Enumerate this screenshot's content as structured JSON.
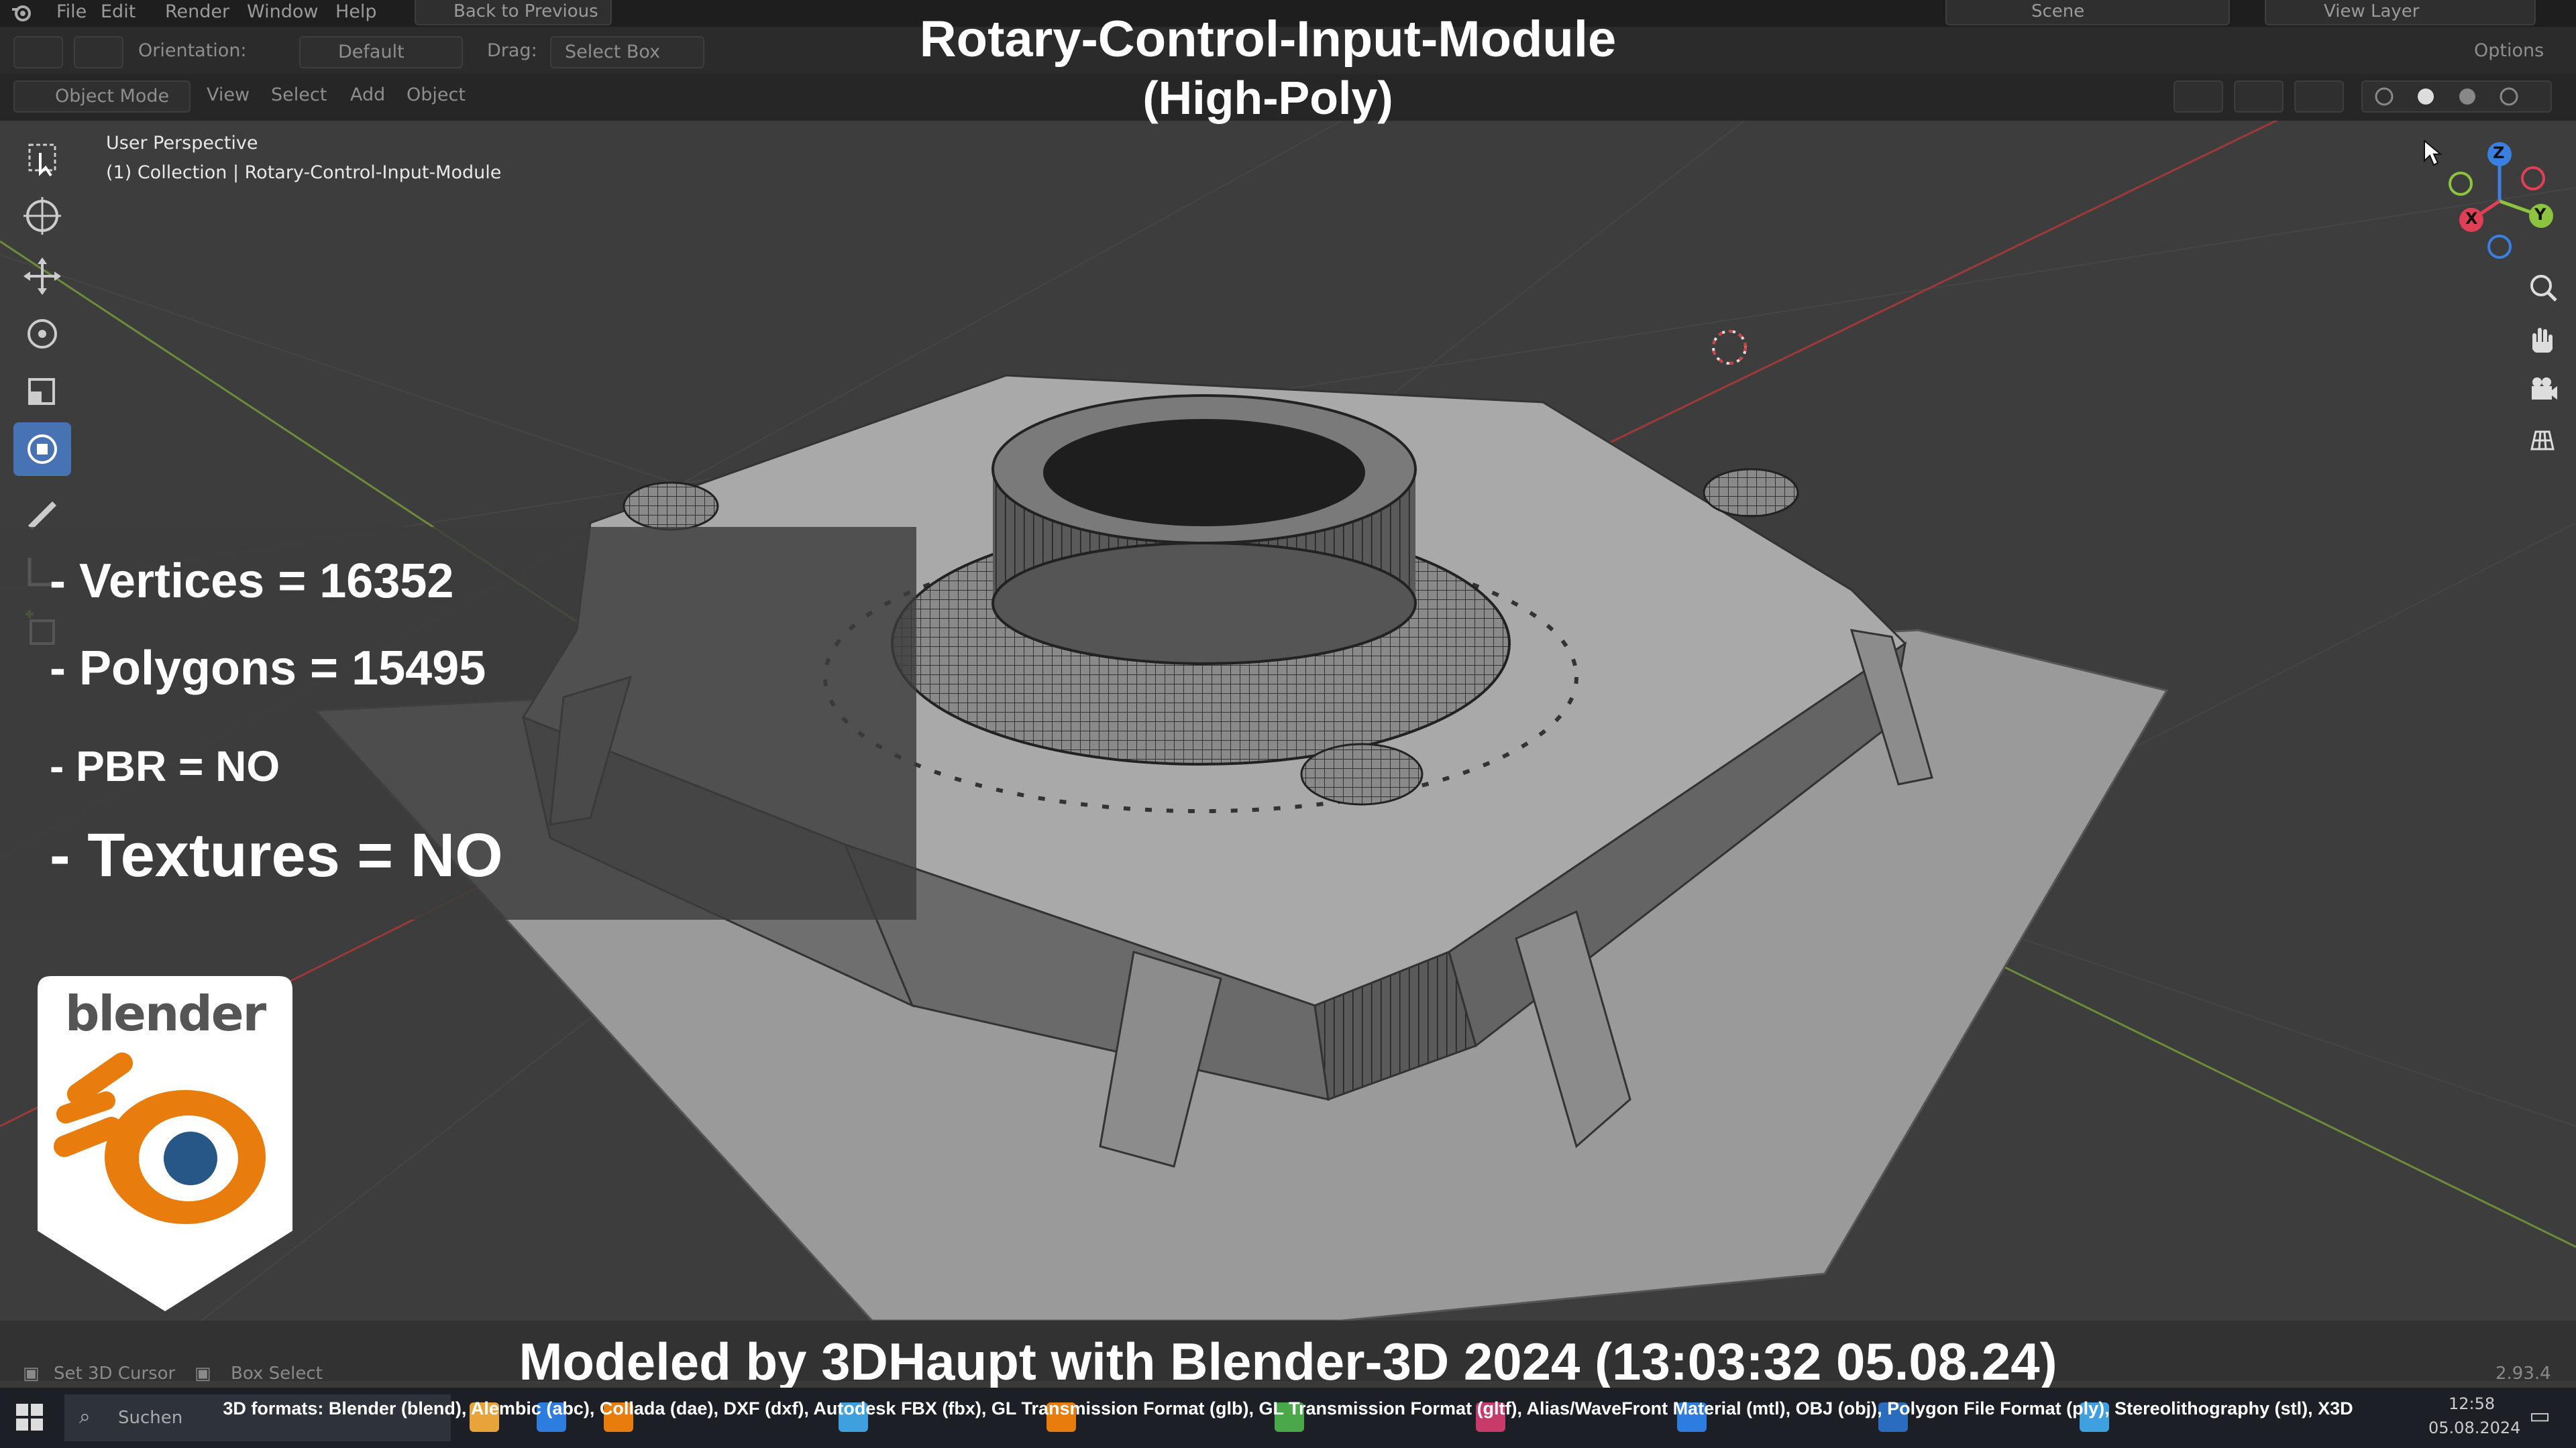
{
  "menubar": {
    "items": [
      "File",
      "Edit",
      "Render",
      "Window",
      "Help"
    ],
    "back_button": "Back to Previous",
    "scene_label": "Scene",
    "view_layer_label": "View Layer"
  },
  "header": {
    "orientation_label": "Orientation:",
    "orientation_value": "Default",
    "drag_label": "Drag:",
    "drag_value": "Select Box",
    "options_label": "Options",
    "mode_value": "Object Mode",
    "menu_items": [
      "View",
      "Select",
      "Add",
      "Object"
    ]
  },
  "viewport": {
    "perspective_label": "User Perspective",
    "collection_label": "(1) Collection | Rotary-Control-Input-Module"
  },
  "gizmo": {
    "z": "Z",
    "y": "Y",
    "x": "X"
  },
  "title": {
    "line1": "Rotary-Control-Input-Module",
    "line2": "(High-Poly)"
  },
  "stats": {
    "vertices": "- Vertices = 16352",
    "polygons": "- Polygons = 15495",
    "pbr": "- PBR =  NO",
    "textures": "- Textures = NO"
  },
  "logo": {
    "text": "blender"
  },
  "footer": {
    "credit": "Modeled by 3DHaupt with Blender-3D 2024 (13:03:32  05.08.24)",
    "formats": "3D formats: Blender (blend), Alembic (abc), Collada (dae), DXF (dxf), Autodesk FBX (fbx), GL Transmission Format (glb), GL Transmission Format (gltf), Alias/WaveFront Material (mtl), OBJ (obj), Polygon File Format (ply), Stereolithography (stl), X3D"
  },
  "statusbar": {
    "set_cursor": "Set 3D Cursor",
    "box_select": "Box Select",
    "version": "2.93.4"
  },
  "taskbar": {
    "search_placeholder": "Suchen",
    "time": "12:58",
    "date": "05.08.2024"
  },
  "colors": {
    "accent": "#4772b3",
    "blender_orange": "#e87d0d",
    "blender_blue": "#265787",
    "axis_x": "#e04055",
    "axis_y": "#8cc43f",
    "axis_z": "#3b7fe0"
  }
}
